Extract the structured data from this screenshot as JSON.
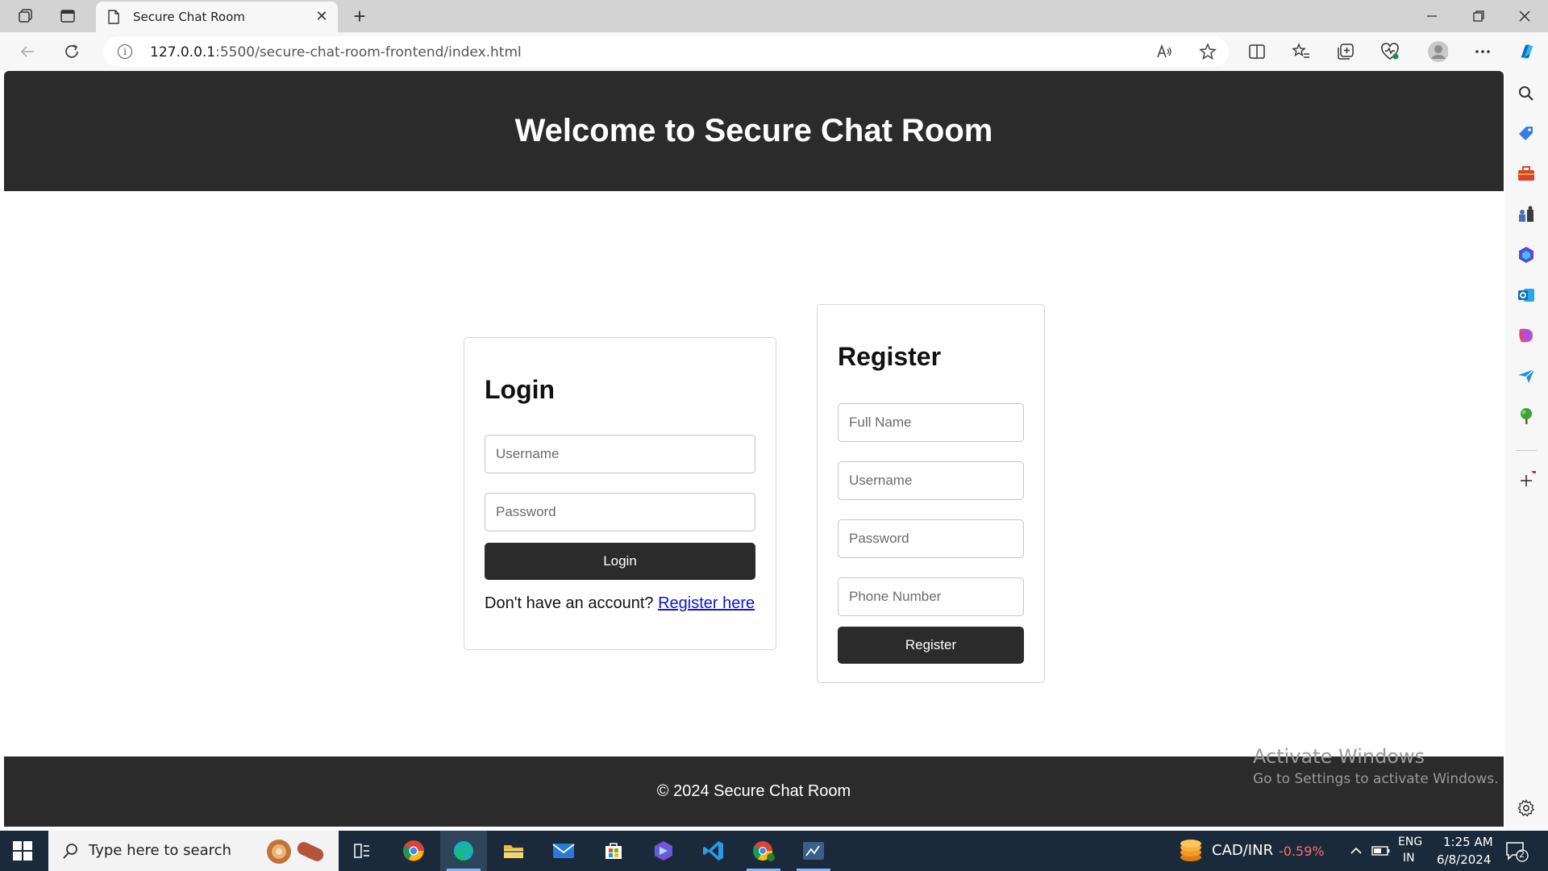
{
  "browser": {
    "tab_title": "Secure Chat Room",
    "url_host": "127.0.0.1",
    "url_path": ":5500/secure-chat-room-frontend/index.html"
  },
  "page": {
    "header_title": "Welcome to Secure Chat Room",
    "login": {
      "heading": "Login",
      "username_placeholder": "Username",
      "password_placeholder": "Password",
      "button_label": "Login",
      "switch_text": "Don't have an account?",
      "switch_link": "Register here"
    },
    "register": {
      "heading": "Register",
      "fullname_placeholder": "Full Name",
      "username_placeholder": "Username",
      "password_placeholder": "Password",
      "phone_placeholder": "Phone Number",
      "button_label": "Register"
    },
    "footer_text": "© 2024 Secure Chat Room"
  },
  "watermark": {
    "title": "Activate Windows",
    "subtitle": "Go to Settings to activate Windows."
  },
  "taskbar": {
    "search_placeholder": "Type here to search",
    "ticker_symbol": "CAD/INR",
    "ticker_change": "-0.59%",
    "language_line1": "ENG",
    "language_line2": "IN",
    "time": "1:25 AM",
    "date": "6/8/2024",
    "notification_count": "2"
  },
  "colors": {
    "header_bg": "#2b2b2b",
    "button_bg": "#2b2b2b",
    "link": "#0b16d6",
    "ticker_negative": "#ff6b6b"
  }
}
